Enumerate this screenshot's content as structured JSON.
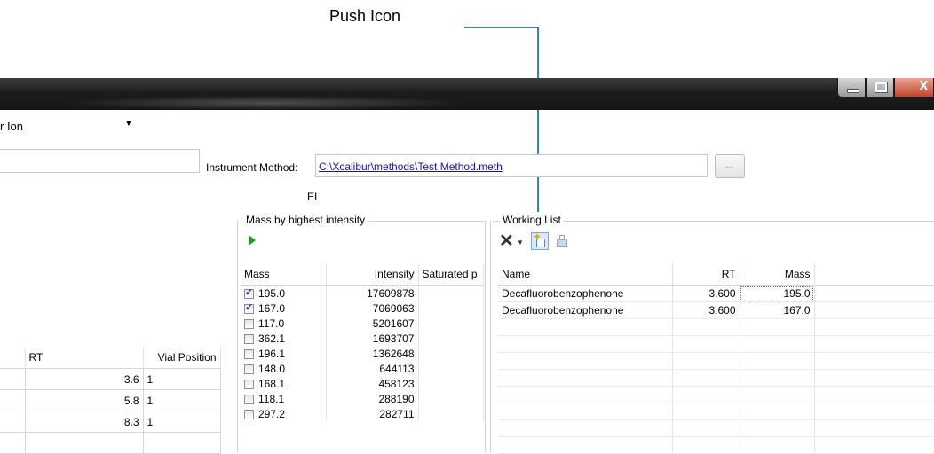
{
  "callout": {
    "label": "Push Icon"
  },
  "titlebar": {
    "close_label": "X"
  },
  "method_type": {
    "selected": "r Ion"
  },
  "instrument": {
    "label": "Instrument Method:",
    "path": "C:\\Xcalibur\\methods\\Test Method.meth",
    "browse_label": "...",
    "ionization": "EI"
  },
  "mass_panel": {
    "title": "Mass by highest intensity",
    "columns": [
      "Mass",
      "Intensity",
      "Saturated p"
    ],
    "rows": [
      {
        "mass": "195.0",
        "intensity": "17609878",
        "checked": true
      },
      {
        "mass": "167.0",
        "intensity": "7069063",
        "checked": true
      },
      {
        "mass": "117.0",
        "intensity": "5201607",
        "checked": false
      },
      {
        "mass": "362.1",
        "intensity": "1693707",
        "checked": false
      },
      {
        "mass": "196.1",
        "intensity": "1362648",
        "checked": false
      },
      {
        "mass": "148.0",
        "intensity": "644113",
        "checked": false
      },
      {
        "mass": "168.1",
        "intensity": "458123",
        "checked": false
      },
      {
        "mass": "118.1",
        "intensity": "288190",
        "checked": false
      },
      {
        "mass": "297.2",
        "intensity": "282711",
        "checked": false
      }
    ]
  },
  "working_list": {
    "title": "Working List",
    "columns": [
      "Name",
      "RT",
      "Mass"
    ],
    "rows": [
      {
        "name": "Decafluorobenzophenone",
        "rt": "3.600",
        "mass": "195.0"
      },
      {
        "name": "Decafluorobenzophenone",
        "rt": "3.600",
        "mass": "167.0"
      }
    ]
  },
  "sample_table": {
    "columns": [
      "RT",
      "Vial Position"
    ],
    "rows": [
      {
        "rt": "3.6",
        "vial": "1"
      },
      {
        "rt": "5.8",
        "vial": "1"
      },
      {
        "rt": "8.3",
        "vial": "1"
      }
    ]
  }
}
